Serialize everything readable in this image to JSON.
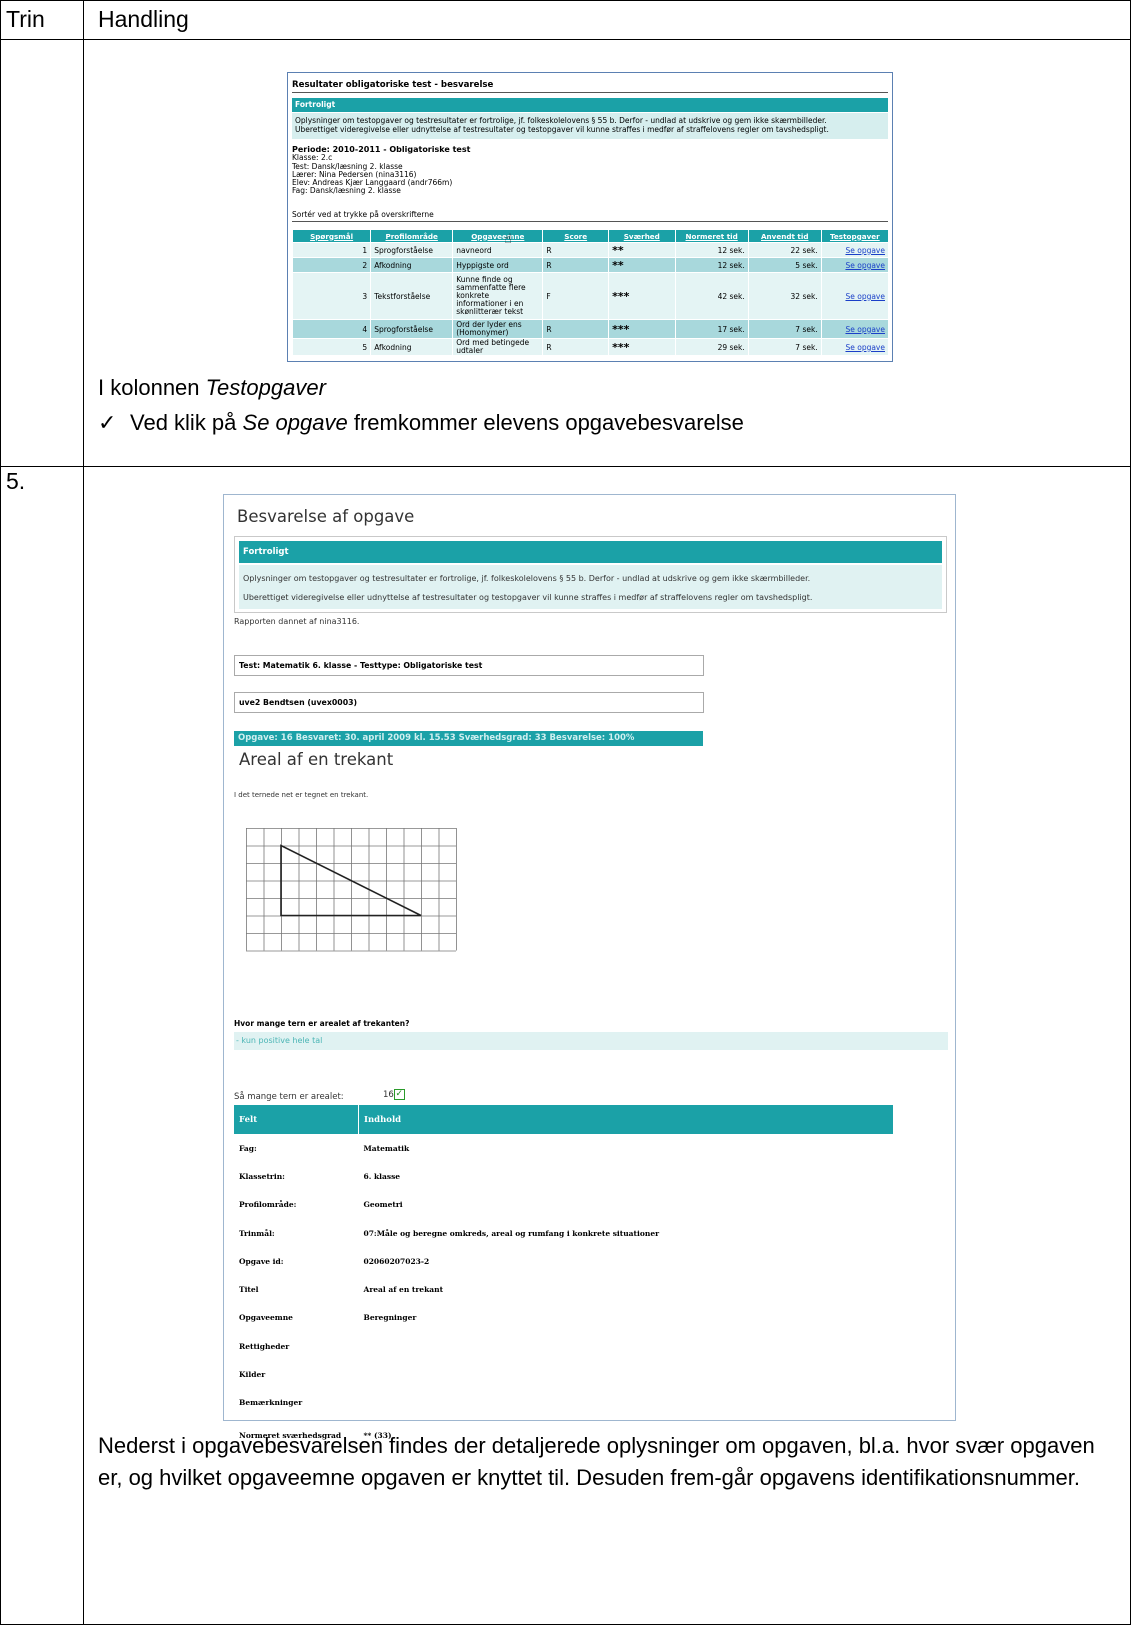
{
  "header": {
    "col1": "Trin",
    "col2": "Handling"
  },
  "step_number": "5.",
  "shot1": {
    "title": "Resultater obligatoriske test - besvarelse",
    "conf_header": "Fortroligt",
    "conf_line1": "Oplysninger om testopgaver og testresultater er fortrolige, jf. folkeskolelovens § 55 b. Derfor - undlad at udskrive og gem ikke skærmbilleder.",
    "conf_line2": "Uberettiget videregivelse eller udnyttelse af testresultater og testopgaver vil kunne straffes i medfør af straffelovens regler om tavshedspligt.",
    "periode": "Periode: 2010-2011 - Obligatoriske test",
    "klasse": "Klasse: 2.c",
    "test": "Test: Dansk/læsning 2. klasse",
    "laerer": "Lærer: Nina Pedersen (nina3116)",
    "elev": "Elev: Andreas Kjær Langgaard (andr766m)",
    "fag": "Fag: Dansk/læsning 2. klasse",
    "sort_hint": "Sortér ved at trykke på overskrifterne",
    "columns": [
      "Spørgsmål",
      "Profilområde",
      "Opgaveemne",
      "Score",
      "Sværhed",
      "Normeret tid",
      "Anvendt tid",
      "Testopgaver"
    ],
    "rows": [
      {
        "n": "1",
        "omr": "Sprogforståelse",
        "emne": "navneord",
        "score": "R",
        "svaer": "**",
        "norm": "12 sek.",
        "anv": "22 sek.",
        "link": "Se opgave"
      },
      {
        "n": "2",
        "omr": "Afkodning",
        "emne": "Hyppigste ord",
        "score": "R",
        "svaer": "**",
        "norm": "12 sek.",
        "anv": "5 sek.",
        "link": "Se opgave"
      },
      {
        "n": "3",
        "omr": "Tekstforståelse",
        "emne": "Kunne finde og sammenfatte flere konkrete informationer i en skønlitterær tekst",
        "score": "F",
        "svaer": "***",
        "norm": "42 sek.",
        "anv": "32 sek.",
        "link": "Se opgave"
      },
      {
        "n": "4",
        "omr": "Sprogforståelse",
        "emne": "Ord der lyder ens (Homonymer)",
        "score": "R",
        "svaer": "***",
        "norm": "17 sek.",
        "anv": "7 sek.",
        "link": "Se opgave"
      },
      {
        "n": "5",
        "omr": "Afkodning",
        "emne": "Ord med betingede udtaler",
        "score": "R",
        "svaer": "***",
        "norm": "29 sek.",
        "anv": "7 sek.",
        "link": "Se opgave"
      }
    ]
  },
  "caption1": {
    "prefix": "I kolonnen ",
    "italic": "Testopgaver"
  },
  "caption2": {
    "prefix": "Ved klik på ",
    "italic": "Se opgave",
    "suffix": " fremkommer elevens opgavebesvarelse"
  },
  "check_mark": "✓",
  "shot2": {
    "title": "Besvarelse af opgave",
    "conf_header": "Fortroligt",
    "conf_line1": "Oplysninger om testopgaver og testresultater er fortrolige, jf. folkeskolelovens § 55 b. Derfor - undlad at udskrive og gem ikke skærmbilleder.",
    "conf_line2": "Uberettiget videregivelse eller udnyttelse af testresultater og testopgaver vil kunne straffes i medfør af straffelovens regler om tavshedspligt.",
    "report_by": "Rapporten dannet af nina3116.",
    "test_line": "Test: Matematik 6. klasse - Testtype: Obligatoriske test",
    "student": "uve2 Bendtsen (uvex0003)",
    "task_bar": "Opgave: 16  Besvaret: 30. april 2009 kl. 15.53  Sværhedsgrad: 33 Besvarelse: 100%",
    "task_title": "Areal af en trekant",
    "intro": "I det ternede net er tegnet en trekant.",
    "question": "Hvor mange tern er arealet af trekanten?",
    "hint": "- kun positive hele tal",
    "answer_label": "Så mange tern er arealet:",
    "answer_value": "16",
    "info_header": [
      "Felt",
      "Indhold"
    ],
    "info_rows": [
      {
        "k": "Fag:",
        "v": "Matematik"
      },
      {
        "k": "Klassetrin:",
        "v": "6. klasse"
      },
      {
        "k": "Profilområde:",
        "v": "Geometri"
      },
      {
        "k": "Trinmål:",
        "v": "07:Måle og beregne omkreds, areal og rumfang i konkrete situationer"
      },
      {
        "k": "Opgave id:",
        "v": "02060207023-2"
      },
      {
        "k": "Titel",
        "v": "Areal af en trekant"
      },
      {
        "k": "Opgaveemne",
        "v": "Beregninger"
      },
      {
        "k": "Rettigheder",
        "v": ""
      },
      {
        "k": "Kilder",
        "v": ""
      },
      {
        "k": "Bemærkninger",
        "v": ""
      },
      {
        "k": "Normeret sværhedsgrad",
        "v": "** (33)"
      }
    ]
  },
  "caption3": "Nederst i opgavebesvarelsen findes der detaljerede oplysninger om opgaven, bl.a. hvor svær opgaven er, og hvilket opgaveemne opgaven er knyttet til. Desuden frem-går opgavens identifikationsnummer."
}
